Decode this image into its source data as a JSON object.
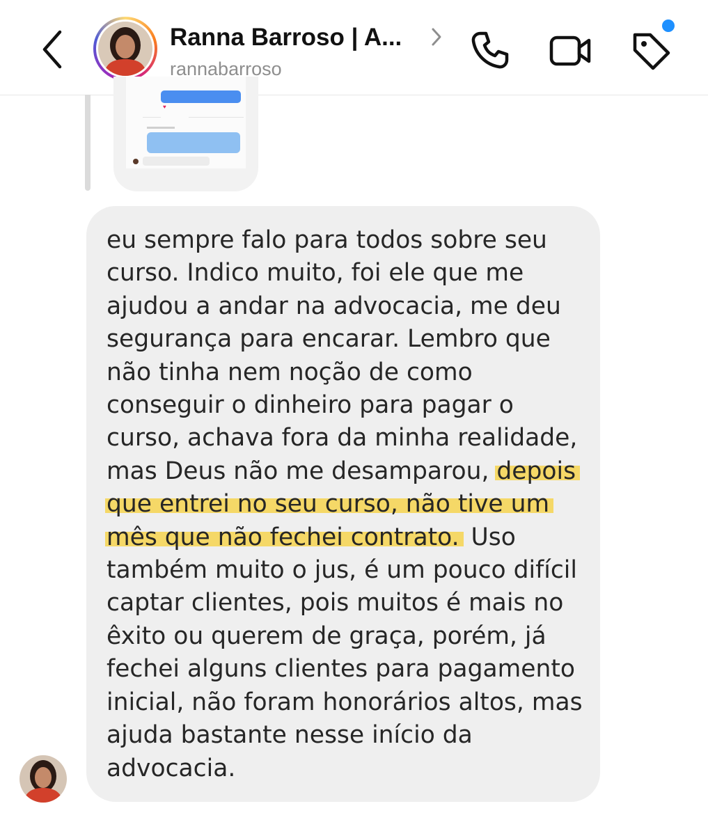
{
  "header": {
    "contact_name": "Ranna Barroso | A...",
    "username": "rannabarroso",
    "icons": {
      "back": "chevron-left-icon",
      "chevron": "chevron-right-icon",
      "phone": "phone-icon",
      "video": "video-camera-icon",
      "tag": "tag-icon"
    },
    "notification_dot_color": "#1e90ff"
  },
  "message": {
    "lines": [
      "eu sempre falo para todos sobre seu",
      "curso. Indico muito, foi ele que me",
      "ajudou a andar na advocacia, me deu",
      "segurança para encarar. Lembro que",
      "não tinha nem noção de como",
      "conseguir o dinheiro para pagar o",
      "curso, achava fora da minha realidade,",
      "mas Deus não me desamparou, ",
      "que entrei no seu curso, não tive um",
      "mês que não fechei contrato.",
      "também muito o jus, é um pouco difícil",
      "captar clientes, pois muitos é mais no",
      "êxito ou querem de graça, porém, já",
      "fechei alguns clientes para pagamento",
      "inicial, não foram honorários altos, mas",
      "ajuda bastante nesse início da",
      "advocacia."
    ],
    "highlight_part1": "depois",
    "highlight_tail": " Uso",
    "highlight_color": "#f5d867",
    "bubble_color": "#efefef"
  }
}
